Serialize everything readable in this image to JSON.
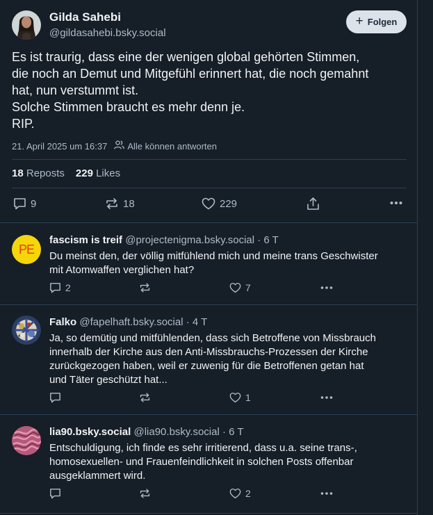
{
  "post": {
    "author_name": "Gilda Sahebi",
    "author_handle": "@gildasahebi.bsky.social",
    "follow_label": "Folgen",
    "text_lines": [
      "Es ist traurig, dass eine der wenigen global gehörten Stimmen,",
      "die noch an Demut und Mitgefühl erinnert hat, die noch gemahnt",
      "hat, nun verstummt ist.",
      "Solche Stimmen braucht es mehr denn je.",
      "RIP."
    ],
    "timestamp": "21. April 2025 um 16:37",
    "reply_setting": "Alle können antworten",
    "reposts_count": "18",
    "reposts_label": "Reposts",
    "likes_count": "229",
    "likes_label": "Likes",
    "reply_count": "9",
    "repost_count": "18",
    "like_count": "229"
  },
  "replies": [
    {
      "name": "fascism is treif",
      "handle": "@projectenigma.bsky.social",
      "age": "· 6 T",
      "avatar_text": "PE",
      "lines": [
        "Du meinst den, der völlig mitfühlend mich und meine trans Geschwister",
        "mit Atomwaffen verglichen hat?"
      ],
      "reply_count": "2",
      "repost_count": "",
      "like_count": "7"
    },
    {
      "name": "Falko",
      "handle": "@fapelhaft.bsky.social",
      "age": "· 4 T",
      "lines": [
        "Ja, so demütig und mitfühlenden, dass sich Betroffene von Missbrauch",
        "innerhalb der Kirche aus den Anti-Missbrauchs-Prozessen der Kirche",
        "zurückgezogen haben, weil er zuwenig für die Betroffenen getan hat",
        "und Täter geschützt hat..."
      ],
      "reply_count": "",
      "repost_count": "",
      "like_count": "1"
    },
    {
      "name": "lia90.bsky.social",
      "handle": "@lia90.bsky.social",
      "age": "· 6 T",
      "lines": [
        "Entschuldigung, ich finde es sehr irritierend, dass u.a. seine trans-,",
        "homosexuellen- und Frauenfeindlichkeit in solchen Posts offenbar",
        "ausgeklammert wird."
      ],
      "reply_count": "",
      "repost_count": "",
      "like_count": "2"
    }
  ],
  "colors": {
    "background": "#161e27",
    "text": "#f1f3f5",
    "muted": "#aebbc9",
    "border": "#2e4052",
    "follow_bg": "#dce2ea",
    "avatar_pe_bg": "#f5d60a",
    "avatar_pe_text": "#e53c1a"
  },
  "icons": [
    "plus-icon",
    "people-icon",
    "reply-icon",
    "repost-icon",
    "like-icon",
    "share-icon",
    "more-icon"
  ]
}
